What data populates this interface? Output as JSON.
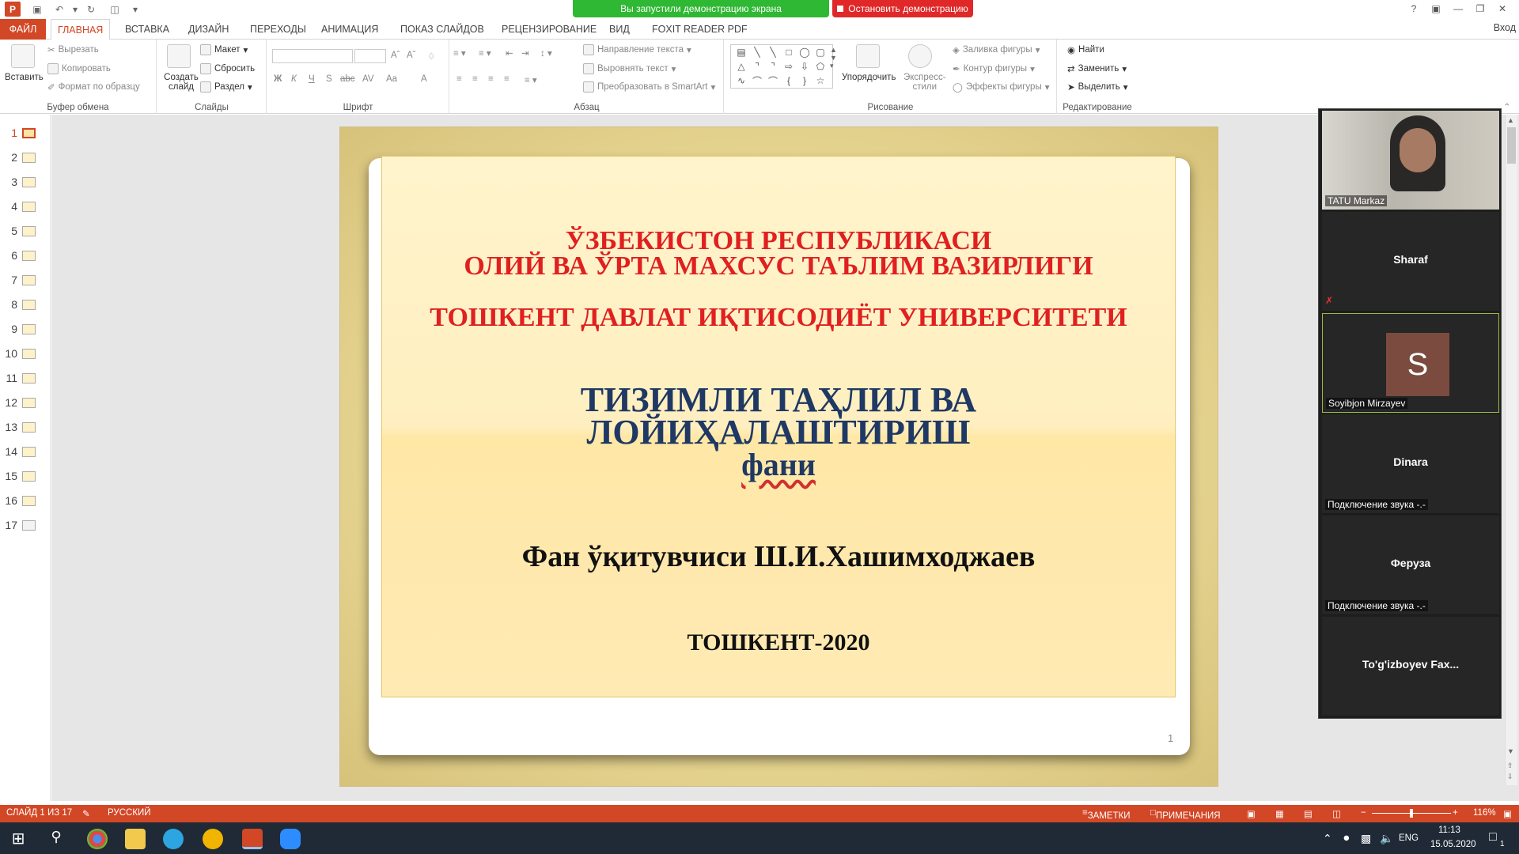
{
  "qat": {
    "icons": [
      "save-icon",
      "undo-icon",
      "redo-icon",
      "start-from-beginning-icon",
      "customize-icon"
    ]
  },
  "share": {
    "banner": "Вы запустили демонстрацию экрана",
    "stop": "Остановить демонстрацию"
  },
  "window": {
    "help": "?",
    "login": "Вход"
  },
  "tabs": [
    "ФАЙЛ",
    "ГЛАВНАЯ",
    "ВСТАВКА",
    "ДИЗАЙН",
    "ПЕРЕХОДЫ",
    "АНИМАЦИЯ",
    "ПОКАЗ СЛАЙДОВ",
    "РЕЦЕНЗИРОВАНИЕ",
    "ВИД",
    "FOXIT READER PDF"
  ],
  "ribbon": {
    "clipboard": {
      "label": "Буфер обмена",
      "paste": "Вставить",
      "cut": "Вырезать",
      "copy": "Копировать",
      "format": "Формат по образцу"
    },
    "slides": {
      "label": "Слайды",
      "new": "Создать слайд",
      "layout": "Макет",
      "reset": "Сбросить",
      "section": "Раздел"
    },
    "font": {
      "label": "Шрифт",
      "bold": "Ж",
      "italic": "К",
      "underline": "Ч",
      "strike": "S",
      "shadow": "abc",
      "spacing": "AV",
      "case": "Aa",
      "color": "A"
    },
    "paragraph": {
      "label": "Абзац",
      "direction": "Направление текста",
      "align": "Выровнять текст",
      "smartart": "Преобразовать в SmartArt"
    },
    "drawing": {
      "label": "Рисование",
      "arrange": "Упорядочить",
      "styles": "Экспресс-стили",
      "fill": "Заливка фигуры",
      "outline": "Контур фигуры",
      "effects": "Эффекты фигуры"
    },
    "editing": {
      "label": "Редактирование",
      "find": "Найти",
      "replace": "Заменить",
      "select": "Выделить"
    }
  },
  "thumbs": [
    "1",
    "2",
    "3",
    "4",
    "5",
    "6",
    "7",
    "8",
    "9",
    "10",
    "11",
    "12",
    "13",
    "14",
    "15",
    "16",
    "17"
  ],
  "slide": {
    "l1": "ЎЗБЕКИСТОН РЕСПУБЛИКАСИ",
    "l2": "ОЛИЙ ВА ЎРТА МАХСУС ТАЪЛИМ ВАЗИРЛИГИ",
    "l3": "ТОШКЕНТ ДАВЛАТ ИҚТИСОДИЁТ УНИВЕРСИТЕТИ",
    "l4": "ТИЗИМЛИ  ТАҲЛИЛ ВА",
    "l5": "ЛОЙИҲАЛАШТИРИШ",
    "l6": "фани",
    "l7": "Фан ўқитувчиси Ш.И.Хашимходжаев",
    "l8": "ТОШКЕНТ-2020",
    "page": "1",
    "red": "#e02020",
    "navy": "#1f3864"
  },
  "zoom": {
    "p1": "TATU Markaz",
    "p2": "Sharaf",
    "p3": "Soyibjon Mirzayev",
    "p3_initial": "S",
    "p4": "Dinara",
    "p4_status": "Подключение звука -.-",
    "p5": "Феруза",
    "p5_status": "Подключение звука -.-",
    "p6": "To'g'izboyev  Fax..."
  },
  "status": {
    "slide": "СЛАЙД 1 ИЗ 17",
    "lang": "РУССКИЙ",
    "notes": "ЗАМЕТКИ",
    "comments": "ПРИМЕЧАНИЯ",
    "zoom": "116%"
  },
  "taskbar": {
    "lang": "ENG",
    "time": "11:13",
    "date": "15.05.2020",
    "notif": "1"
  }
}
